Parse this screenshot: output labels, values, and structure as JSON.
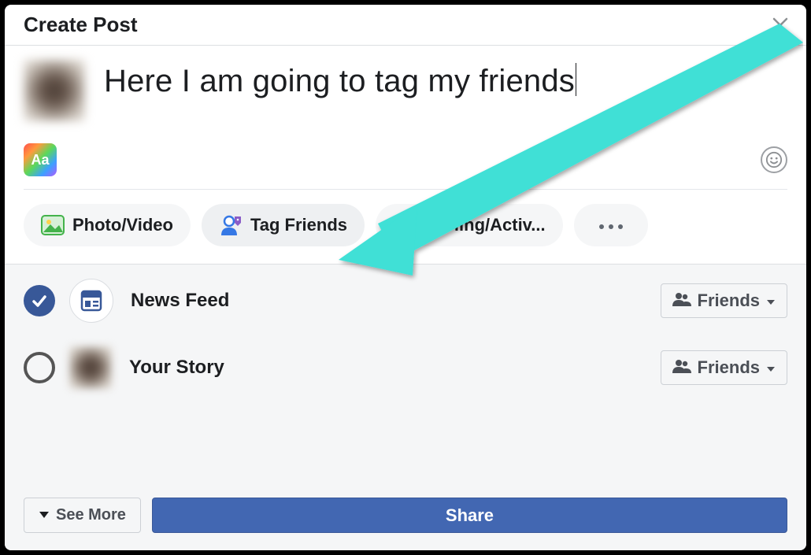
{
  "header": {
    "title": "Create Post"
  },
  "compose": {
    "text": "Here I am going to tag my friends",
    "bg_button_label": "Aa"
  },
  "attachments": {
    "photo_video": "Photo/Video",
    "tag_friends": "Tag Friends",
    "feeling_activity": "Feeling/Activ..."
  },
  "destinations": [
    {
      "label": "News Feed",
      "audience_label": "Friends",
      "selected": true
    },
    {
      "label": "Your Story",
      "audience_label": "Friends",
      "selected": false
    }
  ],
  "actions": {
    "see_more": "See More",
    "share": "Share"
  }
}
